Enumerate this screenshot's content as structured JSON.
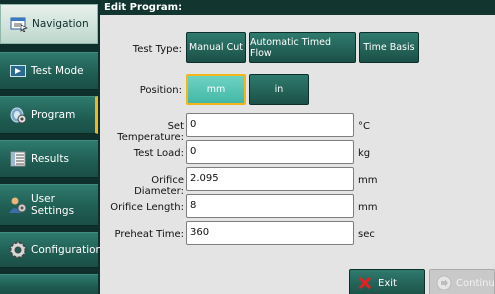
{
  "header": {
    "title": "Edit Program:"
  },
  "sidebar": {
    "items": [
      {
        "label": "Navigation",
        "icon": "navigation-icon"
      },
      {
        "label": "Test Mode",
        "icon": "test-mode-icon"
      },
      {
        "label": "Program",
        "icon": "program-icon"
      },
      {
        "label": "Results",
        "icon": "results-icon"
      },
      {
        "label_line1": "User",
        "label_line2": "Settings",
        "icon": "user-settings-icon"
      },
      {
        "label": "Configuration",
        "icon": "configuration-icon"
      }
    ]
  },
  "form": {
    "test_type": {
      "label": "Test Type:",
      "options": [
        "Manual Cut",
        "Automatic Timed Flow",
        "Time Basis"
      ],
      "selected": ""
    },
    "position": {
      "label": "Position:",
      "options": [
        "mm",
        "in"
      ],
      "selected": "mm"
    },
    "fields": [
      {
        "label": "Set Temperature:",
        "value": "0",
        "unit": "°C"
      },
      {
        "label": "Test Load:",
        "value": "0",
        "unit": "kg"
      },
      {
        "label": "Orifice Diameter:",
        "value": "2.095",
        "unit": "mm"
      },
      {
        "label": "Orifice Length:",
        "value": "8",
        "unit": "mm"
      },
      {
        "label": "Preheat Time:",
        "value": "360",
        "unit": "sec"
      }
    ]
  },
  "actions": {
    "exit_label": "Exit",
    "continue_label": "Continue"
  },
  "colors": {
    "accent": "#f2b51c",
    "teal": "#1f5c52",
    "teal_light": "#43b8a6",
    "dark": "#0e2f2b"
  }
}
